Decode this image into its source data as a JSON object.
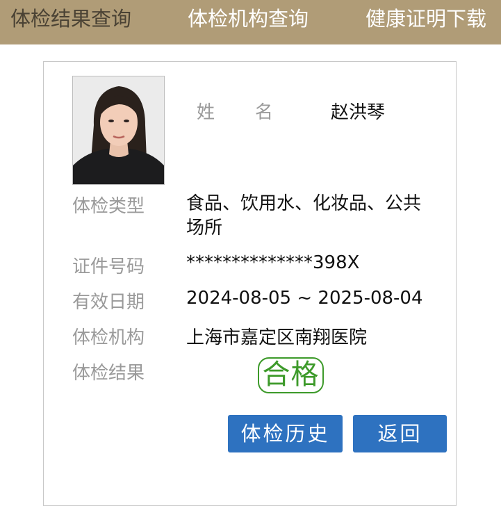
{
  "nav": {
    "tabs": [
      {
        "label": "体检结果查询",
        "active": true
      },
      {
        "label": "体检机构查询",
        "active": false
      },
      {
        "label": "健康证明下载",
        "active": false
      }
    ]
  },
  "colors": {
    "nav_bg": "#b09c77",
    "active_tab_text": "#4a4234",
    "label_text": "#9a9a9a",
    "stamp_green": "#3d9a2a",
    "button_blue": "#2e72c0"
  },
  "record": {
    "name_label_chars": [
      "姓",
      "名"
    ],
    "name": "赵洪琴",
    "exam_type_label": "体检类型",
    "exam_type": "食品、饮用水、化妆品、公共场所",
    "id_label": "证件号码",
    "id_number": "**************398X",
    "validity_label": "有效日期",
    "validity": "2024-08-05 ~ 2025-08-04",
    "institution_label": "体检机构",
    "institution": "上海市嘉定区南翔医院",
    "result_label": "体检结果",
    "result": "合格"
  },
  "buttons": {
    "history": "体检历史",
    "back": "返回"
  }
}
